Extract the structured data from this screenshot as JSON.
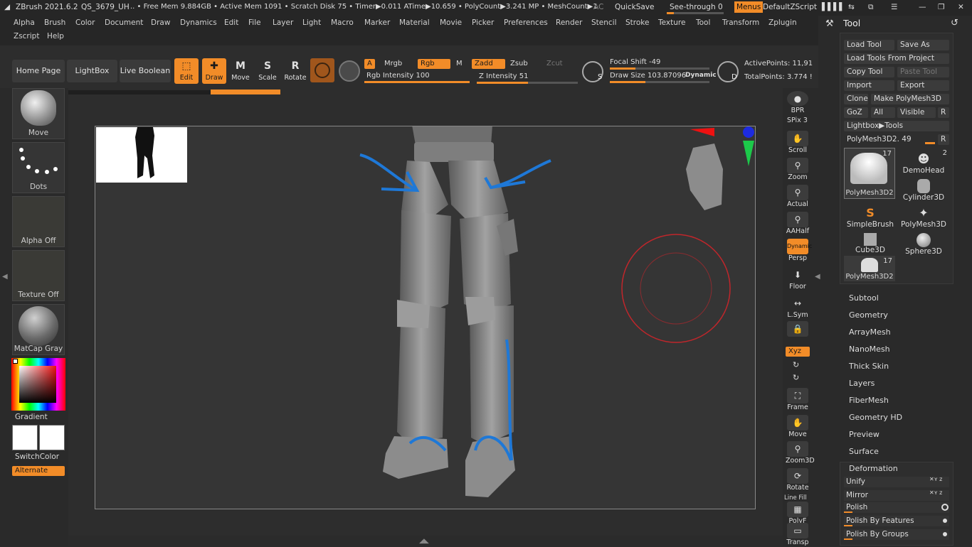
{
  "titlebar": {
    "app": "ZBrush 2021.6.2",
    "project": "QS_3679_UH",
    "stats": ".. • Free Mem 9.884GB • Active Mem 1091 • Scratch Disk 75 •  Timer▶0.011 ATime▶10.659 • PolyCount▶3.241 MP  • MeshCount▶1",
    "ac": "AC",
    "quicksave": "QuickSave",
    "seethrough": "See-through  0",
    "menus": "Menus",
    "script": "DefaultZScript"
  },
  "menubar": {
    "row1": [
      "Alpha",
      "Brush",
      "Color",
      "Document",
      "Draw",
      "Dynamics",
      "Edit",
      "File",
      "Layer",
      "Light",
      "Macro",
      "Marker",
      "Material",
      "Movie",
      "Picker",
      "Preferences",
      "Render",
      "Stencil",
      "Stroke",
      "Texture",
      "Tool",
      "Transform",
      "Zplugin"
    ],
    "row2": [
      "Zscript",
      "Help"
    ]
  },
  "shelf": {
    "home": "Home Page",
    "lightbox": "LightBox",
    "liveboolean": "Live Boolean",
    "edit": "Edit",
    "draw": "Draw",
    "move": "Move",
    "scale": "Scale",
    "rotate": "Rotate",
    "a": "A",
    "mrgb": "Mrgb",
    "rgb": "Rgb",
    "m": "M",
    "zadd": "Zadd",
    "zsub": "Zsub",
    "zcut": "Zcut",
    "rgb_intensity": "Rgb Intensity 100",
    "z_intensity": "Z Intensity 51",
    "focal_shift": "Focal Shift -49",
    "draw_size": "Draw Size 103.87096",
    "dynamic": "Dynamic",
    "active_points": "ActivePoints: 11,91",
    "total_points": "TotalPoints: 3.774 !",
    "s": "S",
    "d": "D",
    "rgb_intensity_pct": 100,
    "z_intensity_pct": 51
  },
  "left": {
    "move": "Move",
    "dots": "Dots",
    "alpha": "Alpha Off",
    "texture": "Texture Off",
    "matcap": "MatCap Gray",
    "gradient": "Gradient",
    "switchcolor": "SwitchColor",
    "alternate": "Alternate"
  },
  "rightstrip": {
    "bpr": "BPR",
    "spix": "SPix 3",
    "scroll": "Scroll",
    "zoom": "Zoom",
    "actual": "Actual",
    "aahalf": "AAHalf",
    "dynamic": "Dynamic",
    "persp": "Persp",
    "floor": "Floor",
    "lsym": "L.Sym",
    "xyz": "Xyz",
    "frame": "Frame",
    "move": "Move",
    "zoom3d": "Zoom3D",
    "rotate": "Rotate",
    "linefill": "Line Fill",
    "polyf": "PolyF",
    "transp": "Transp"
  },
  "tool": {
    "title": "Tool",
    "load_tool": "Load Tool",
    "save_as": "Save As",
    "load_from_project": "Load Tools From Project",
    "copy_tool": "Copy Tool",
    "paste_tool": "Paste Tool",
    "import": "Import",
    "export": "Export",
    "clone": "Clone",
    "make_polymesh": "Make PolyMesh3D",
    "goz": "GoZ",
    "all": "All",
    "visible": "Visible",
    "r": "R",
    "lightbox_tools": "Lightbox▶Tools",
    "current": "PolyMesh3D2. 49",
    "current_r": "R",
    "tiles": [
      {
        "label": "PolyMesh3D2",
        "count": "17"
      },
      {
        "label": "DemoHead",
        "count": "2"
      },
      {
        "label": "Cylinder3D",
        "count": ""
      },
      {
        "label": "SimpleBrush",
        "count": ""
      },
      {
        "label": "PolyMesh3D",
        "count": ""
      },
      {
        "label": "Cube3D",
        "count": ""
      },
      {
        "label": "Sphere3D",
        "count": ""
      },
      {
        "label": "PolyMesh3D2",
        "count": "17"
      }
    ],
    "sections": [
      "Subtool",
      "Geometry",
      "ArrayMesh",
      "NanoMesh",
      "Thick Skin",
      "Layers",
      "FiberMesh",
      "Geometry HD",
      "Preview",
      "Surface"
    ],
    "deformation": "Deformation",
    "unify": "Unify",
    "mirror": "Mirror",
    "polish": "Polish",
    "polish_features": "Polish By Features",
    "polish_groups": "Polish By Groups"
  },
  "colors": {
    "accent": "#f28c28",
    "stroke": "#1e78d7",
    "cursor": "#c0262b"
  }
}
